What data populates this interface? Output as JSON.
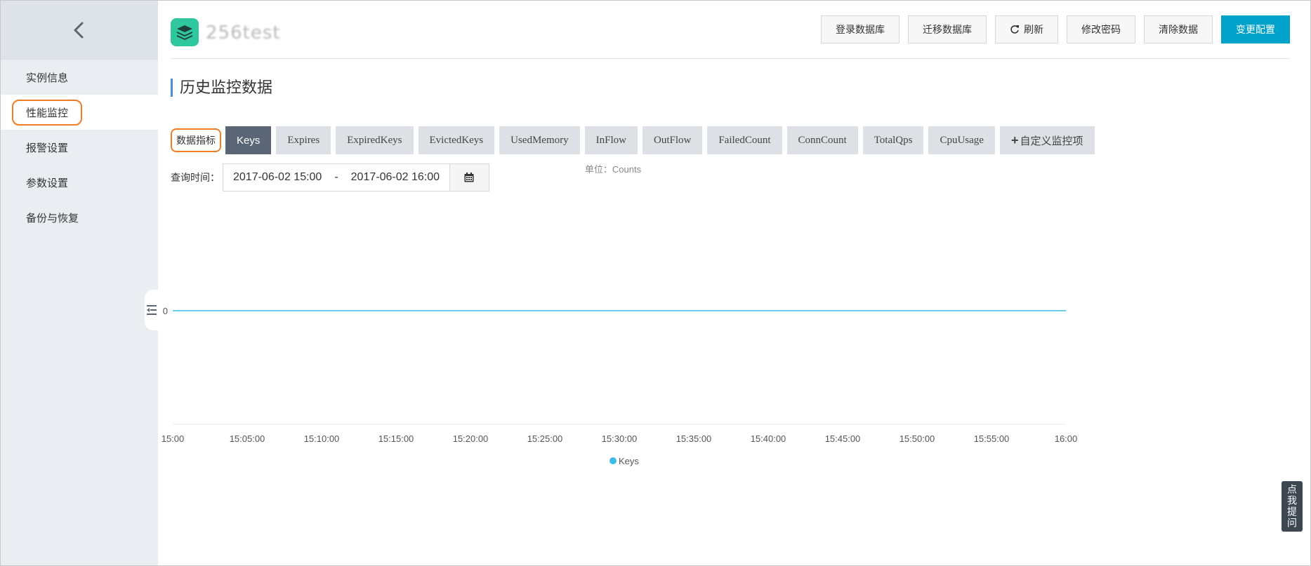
{
  "sidebar": {
    "items": [
      {
        "label": "实例信息"
      },
      {
        "label": "性能监控"
      },
      {
        "label": "报警设置"
      },
      {
        "label": "参数设置"
      },
      {
        "label": "备份与恢复"
      }
    ],
    "active_index": 1
  },
  "header": {
    "instance_name": "256test",
    "buttons": {
      "login_db": "登录数据库",
      "migrate_db": "迁移数据库",
      "refresh": "刷新",
      "change_password": "修改密码",
      "clear_data": "清除数据",
      "change_config": "变更配置"
    }
  },
  "page": {
    "section_title": "历史监控数据",
    "metric_label": "数据指标",
    "metric_tabs": [
      "Keys",
      "Expires",
      "ExpiredKeys",
      "EvictedKeys",
      "UsedMemory",
      "InFlow",
      "OutFlow",
      "FailedCount",
      "ConnCount",
      "TotalQps",
      "CpuUsage"
    ],
    "active_metric": 0,
    "custom_metric": "自定义监控项",
    "query_time_label": "查询时间：",
    "time_start": "2017-06-02 15:00",
    "time_separator": "-",
    "time_end": "2017-06-02 16:00"
  },
  "help": {
    "label": "点我提问"
  },
  "colors": {
    "accent": "#00a2ca",
    "highlight": "#f07c24",
    "series": "#3cbbe9",
    "active_tab": "#5a6675"
  },
  "chart_data": {
    "type": "line",
    "unit_label": "单位：Counts",
    "x": [
      "15:00",
      "15:05:00",
      "15:10:00",
      "15:15:00",
      "15:20:00",
      "15:25:00",
      "15:30:00",
      "15:35:00",
      "15:40:00",
      "15:45:00",
      "15:50:00",
      "15:55:00",
      "16:00"
    ],
    "series": [
      {
        "name": "Keys",
        "values": [
          0,
          0,
          0,
          0,
          0,
          0,
          0,
          0,
          0,
          0,
          0,
          0,
          0
        ]
      }
    ],
    "y_ticks": [
      "0"
    ],
    "legend": "bottom-center"
  }
}
